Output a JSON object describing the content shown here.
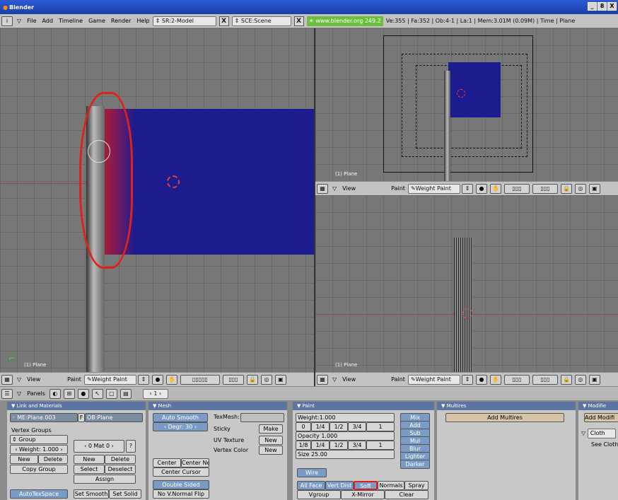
{
  "window": {
    "title": "Blender",
    "buttons": [
      "_",
      "8",
      "X"
    ]
  },
  "menubar": {
    "items": [
      "File",
      "Add",
      "Timeline",
      "Game",
      "Render",
      "Help"
    ],
    "screen": "SR:2-Model",
    "scene": "SCE:Scene",
    "url": "www.blender.org 249.2",
    "stats": "Ve:355 | Fa:352 | Ob:4-1 | La:1  | Mem:3.01M (0.09M)  | Time | Plane"
  },
  "viewports": {
    "left": {
      "label": "(1) Plane",
      "header": {
        "view": "View",
        "mode": "Paint",
        "paint_mode": "Weight Paint"
      }
    },
    "top_right": {
      "label": "(1) Plane",
      "header": {
        "view": "View",
        "mode": "Paint",
        "paint_mode": "Weight Paint"
      }
    },
    "bottom_right": {
      "label": "(1) Plane",
      "header": {
        "view": "View",
        "mode": "Paint",
        "paint_mode": "Weight Paint"
      }
    }
  },
  "buttons_header": {
    "panels": "Panels",
    "frame": "1"
  },
  "panels": {
    "link": {
      "title": "Link and Materials",
      "mesh_name": "ME:Plane.003",
      "f": "F",
      "ob_name": "OB:Plane",
      "vertex_groups": "Vertex Groups",
      "group": "Group",
      "weight": "Weight: 1.000",
      "new": "New",
      "delete": "Delete",
      "copy_group": "Copy Group",
      "mat": "0 Mat 0",
      "q": "?",
      "mat_new": "New",
      "mat_delete": "Delete",
      "select": "Select",
      "deselect": "Deselect",
      "assign": "Assign",
      "autotex": "AutoTexSpace",
      "set_smooth": "Set Smooth",
      "set_solid": "Set Solid"
    },
    "mesh": {
      "title": "Mesh",
      "auto_smooth": "Auto Smooth",
      "degr": "Degr: 30",
      "texmesh": "TexMesh:",
      "sticky": "Sticky",
      "make": "Make",
      "uv_texture": "UV Texture",
      "uv_new": "New",
      "vertex_color": "Vertex Color",
      "vc_new": "New",
      "center": "Center",
      "center_new": "Center New",
      "center_cursor": "Center Cursor",
      "double_sided": "Double Sided",
      "no_vnormal": "No V.Normal Flip"
    },
    "paint": {
      "title": "Paint",
      "weight": "Weight:1.000",
      "row1": [
        "0",
        "1/4",
        "1/2",
        "3/4",
        "1"
      ],
      "opacity": "Opacity 1.000",
      "row2": [
        "1/8",
        "1/4",
        "1/2",
        "3/4",
        "1"
      ],
      "size": "Size 25.00",
      "modes": [
        "Mix",
        "Add",
        "Sub",
        "Mul",
        "Blur",
        "Lighter",
        "Darker"
      ],
      "wire": "Wire",
      "all_face": "All Face",
      "vert_dist": "Vert Dist",
      "soft": "Soft",
      "normals": "Normals",
      "spray": "Spray",
      "vgroup": "Vgroup",
      "xmirror": "X-Mirror",
      "clear": "Clear"
    },
    "multires": {
      "title": "Multires",
      "add": "Add Multires"
    },
    "modifiers": {
      "title": "Modifie",
      "add": "Add Modifi",
      "cloth": "Cloth",
      "see": "See Cloth"
    }
  },
  "colors": {
    "mesh": "#1c1c8e",
    "annotation": "#e0201c",
    "panel_title": "#5c75a0"
  }
}
